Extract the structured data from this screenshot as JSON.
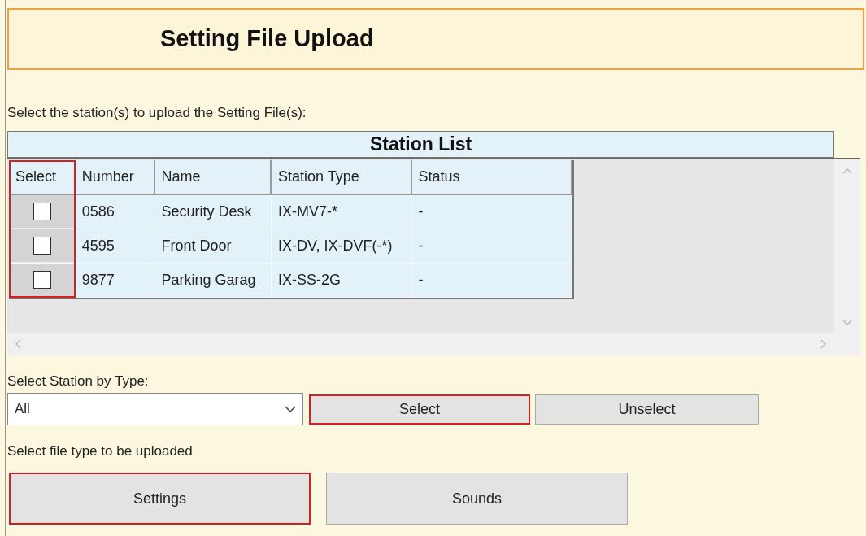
{
  "title": "Setting File Upload",
  "instruction": "Select the station(s) to upload the Setting File(s):",
  "station_list": {
    "title": "Station List",
    "columns": [
      {
        "label": "Select",
        "highlighted": true
      },
      {
        "label": "Number",
        "highlighted": false
      },
      {
        "label": "Name",
        "highlighted": false
      },
      {
        "label": "Station Type",
        "highlighted": false
      },
      {
        "label": "Status",
        "highlighted": false
      }
    ],
    "rows": [
      {
        "checked": false,
        "number": "0586",
        "name": "Security Desk",
        "station_type": "IX-MV7-*",
        "status": "-"
      },
      {
        "checked": false,
        "number": "4595",
        "name": "Front Door",
        "station_type": "IX-DV, IX-DVF(-*)",
        "status": "-"
      },
      {
        "checked": false,
        "number": "9877",
        "name": "Parking Garag",
        "station_type": "IX-SS-2G",
        "status": "-"
      }
    ]
  },
  "type_select": {
    "label": "Select Station by Type:",
    "value": "All",
    "buttons": [
      {
        "label": "Select",
        "highlighted": true
      },
      {
        "label": "Unselect",
        "highlighted": false
      }
    ]
  },
  "file_type": {
    "label": "Select file type to be uploaded",
    "buttons": [
      {
        "label": "Settings",
        "highlighted": true
      },
      {
        "label": "Sounds",
        "highlighted": false
      }
    ]
  }
}
